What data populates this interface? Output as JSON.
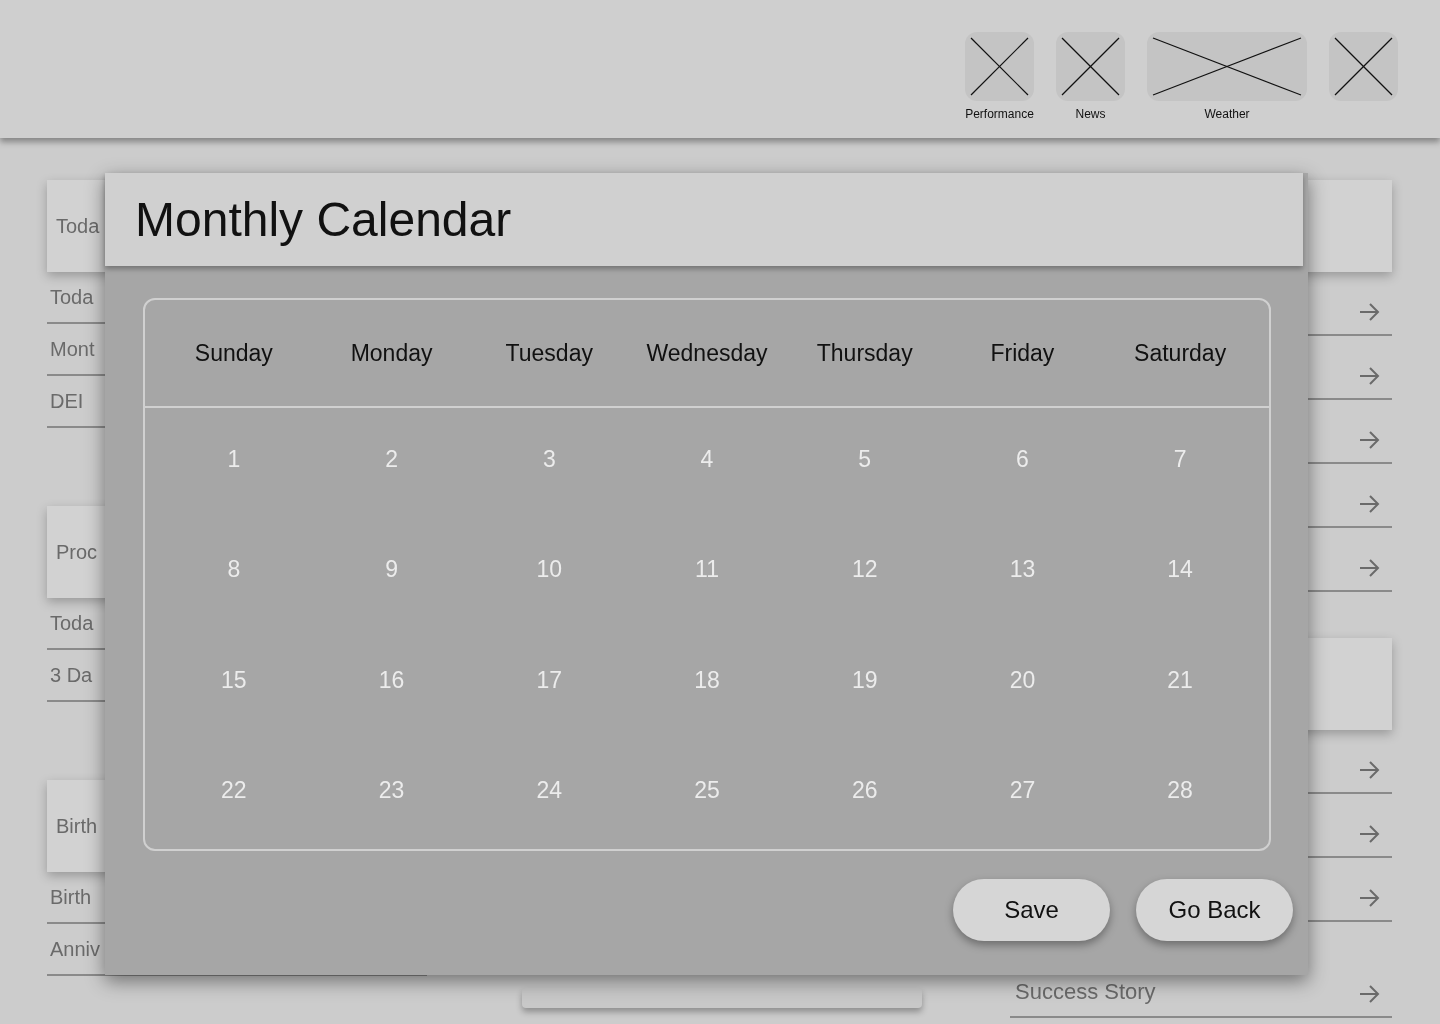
{
  "top_bar": {
    "tiles": [
      {
        "kind": "square",
        "label": "Performance"
      },
      {
        "kind": "square",
        "label": "News"
      },
      {
        "kind": "wide",
        "label": "Weather"
      },
      {
        "kind": "square"
      }
    ]
  },
  "left_sections": [
    {
      "title": "Toda",
      "rows": [
        "Toda",
        "Mont",
        "DEI"
      ]
    },
    {
      "title": "Proc",
      "rows": [
        "Toda",
        "3 Da"
      ]
    },
    {
      "title": "Birth",
      "rows": [
        "Birth",
        "Anniv"
      ]
    }
  ],
  "right_sections": [
    {
      "rows": [
        {
          "kind": "link"
        },
        {
          "kind": "link"
        },
        {
          "kind": "link"
        },
        {
          "kind": "link"
        },
        {
          "kind": "link"
        }
      ]
    },
    {
      "rows": [
        {
          "kind": "link"
        },
        {
          "kind": "link"
        },
        {
          "kind": "link"
        },
        {
          "kind": "link",
          "label": "Success Story"
        }
      ]
    }
  ],
  "modal": {
    "title": "Monthly Calendar",
    "weekdays": [
      "Sunday",
      "Monday",
      "Tuesday",
      "Wednesday",
      "Thursday",
      "Friday",
      "Saturday"
    ],
    "days": [
      "1",
      "2",
      "3",
      "4",
      "5",
      "6",
      "7",
      "8",
      "9",
      "10",
      "11",
      "12",
      "13",
      "14",
      "15",
      "16",
      "17",
      "18",
      "19",
      "20",
      "21",
      "22",
      "23",
      "24",
      "25",
      "26",
      "27",
      "28"
    ],
    "buttons": [
      "Save",
      "Go Back"
    ]
  }
}
